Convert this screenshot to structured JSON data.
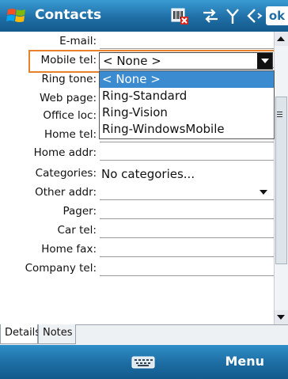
{
  "title_bar": {
    "app_title": "Contacts",
    "ok_label": "ok"
  },
  "form": {
    "rows": [
      {
        "label": "E-mail:",
        "value": ""
      },
      {
        "label": "Mobile tel:",
        "value": ""
      },
      {
        "label": "Ring tone:",
        "value": "< None >"
      },
      {
        "label": "Web page:",
        "value": ""
      },
      {
        "label": "Office loc:",
        "value": ""
      },
      {
        "label": "Home tel:",
        "value": ""
      },
      {
        "label": "Home addr:",
        "value": ""
      },
      {
        "label": "Categories:",
        "value": "No categories..."
      },
      {
        "label": "Other addr:",
        "value": ""
      },
      {
        "label": "Pager:",
        "value": ""
      },
      {
        "label": "Car tel:",
        "value": ""
      },
      {
        "label": "Home fax:",
        "value": ""
      },
      {
        "label": "Company tel:",
        "value": ""
      }
    ],
    "ring_tone_options": [
      "< None >",
      "Ring-Standard",
      "Ring-Vision",
      "Ring-WindowsMobile"
    ],
    "ring_tone_selected": "< None >"
  },
  "tabs": [
    "Details",
    "Notes"
  ],
  "softkeys": {
    "right": "Menu"
  },
  "colors": {
    "titlebar": "#1f6fa6",
    "selection": "#3b8bd1",
    "highlight_box": "#e8812c"
  },
  "icons": [
    "windows-flag-icon",
    "no-signal-icon",
    "connectivity-icon",
    "antenna-icon",
    "volume-icon",
    "keyboard-icon"
  ]
}
